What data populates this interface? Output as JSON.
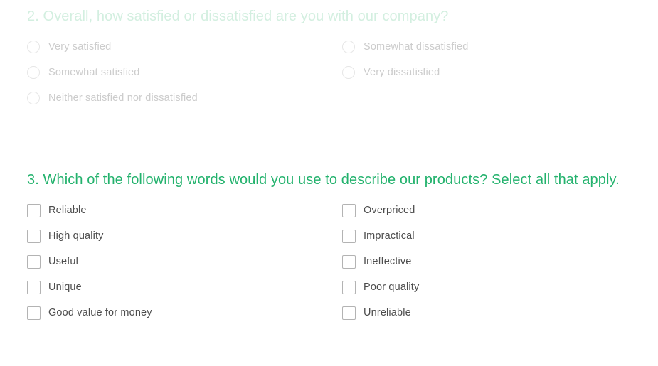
{
  "page": {
    "background_color": "#ffffff",
    "type": "survey-form"
  },
  "questions": [
    {
      "id": "question-2",
      "number": "2.",
      "state": "faded",
      "title": "2. Overall, how satisfied or dissatisfied are you with our company?",
      "title_color": "#d3efe0",
      "label_color": "#cccccc",
      "input_type": "radio",
      "columns": 2,
      "options": [
        {
          "label": "Very satisfied",
          "column": 1,
          "checked": false
        },
        {
          "label": "Somewhat satisfied",
          "column": 1,
          "checked": false
        },
        {
          "label": "Neither satisfied nor dissatisfied",
          "column": 1,
          "checked": false
        },
        {
          "label": "Somewhat dissatisfied",
          "column": 2,
          "checked": false
        },
        {
          "label": "Very dissatisfied",
          "column": 2,
          "checked": false
        }
      ]
    },
    {
      "id": "question-3",
      "number": "3.",
      "state": "active",
      "title": "3. Which of the following words would you use to describe our products? Select all that apply.",
      "title_color": "#23b26d",
      "label_color": "#4d4d4d",
      "input_type": "checkbox",
      "columns": 2,
      "options": [
        {
          "label": "Reliable",
          "column": 1,
          "checked": false
        },
        {
          "label": "High quality",
          "column": 1,
          "checked": false
        },
        {
          "label": "Useful",
          "column": 1,
          "checked": false
        },
        {
          "label": "Unique",
          "column": 1,
          "checked": false
        },
        {
          "label": "Good value for money",
          "column": 1,
          "checked": false
        },
        {
          "label": "Overpriced",
          "column": 2,
          "checked": false
        },
        {
          "label": "Impractical",
          "column": 2,
          "checked": false
        },
        {
          "label": "Ineffective",
          "column": 2,
          "checked": false
        },
        {
          "label": "Poor quality",
          "column": 2,
          "checked": false
        },
        {
          "label": "Unreliable",
          "column": 2,
          "checked": false
        }
      ]
    }
  ]
}
